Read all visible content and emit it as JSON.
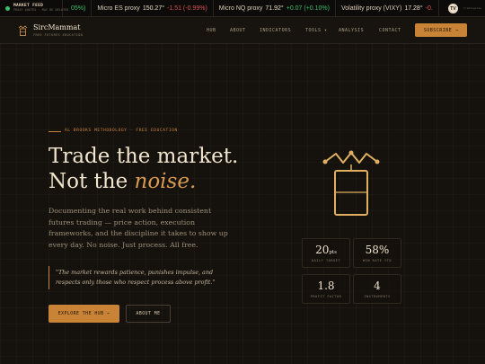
{
  "ticker": {
    "feed_title": "MARKET FEED",
    "feed_sub": "PROXY QUOTES · MAY BE DELAYED",
    "items": [
      {
        "name": "",
        "value": "05%)",
        "change": "",
        "direction": "pos"
      },
      {
        "name": "Micro ES proxy",
        "value": "150.27°",
        "change": "-1.51 (-0.99%)",
        "direction": "neg"
      },
      {
        "name": "Micro NQ proxy",
        "value": "71.92°",
        "change": "+0.07 (+0.10%)",
        "direction": "pos"
      },
      {
        "name": "Volatility proxy (VIXY)",
        "value": "17.28°",
        "change": "-0.",
        "direction": "neg"
      }
    ],
    "badge": "TV",
    "powered": "tradingview"
  },
  "nav": {
    "brand": "SircMammat",
    "brand_sub": "FREE FUTURES EDUCATION",
    "links": [
      "HUB",
      "ABOUT",
      "INDICATORS",
      "TOOLS ▾",
      "ANALYSIS",
      "CONTACT"
    ],
    "subscribe": "SUBSCRIBE →"
  },
  "hero": {
    "eyebrow": "AL BROOKS METHODOLOGY · FREE EDUCATION",
    "title_line1": "Trade the market.",
    "title_line2_pre": "Not the ",
    "title_line2_em": "noise.",
    "lead": "Documenting the real work behind consistent futures trading — price action, execution frameworks, and the discipline it takes to show up every day. No noise. Just process. All free.",
    "quote": "\"The market rewards patience, punishes impulse, and respects only those who respect process above profit.\"",
    "primary_cta": "EXPLORE THE HUB →",
    "secondary_cta": "ABOUT ME"
  },
  "stats": [
    {
      "value": "20",
      "unit": "pts",
      "label": "DAILY TARGET"
    },
    {
      "value": "58%",
      "unit": "",
      "label": "WIN RATE YTD"
    },
    {
      "value": "1.8",
      "unit": "",
      "label": "PROFIT FACTOR"
    },
    {
      "value": "4",
      "unit": "",
      "label": "INSTRUMENTS"
    }
  ],
  "colors": {
    "accent": "#c98336",
    "background": "#15120e",
    "positive": "#3bbf6a",
    "negative": "#d9534f"
  },
  "icons": {
    "logo": "crown-candle-icon",
    "hero": "crown-candle-icon",
    "feed": "live-dot-icon"
  }
}
